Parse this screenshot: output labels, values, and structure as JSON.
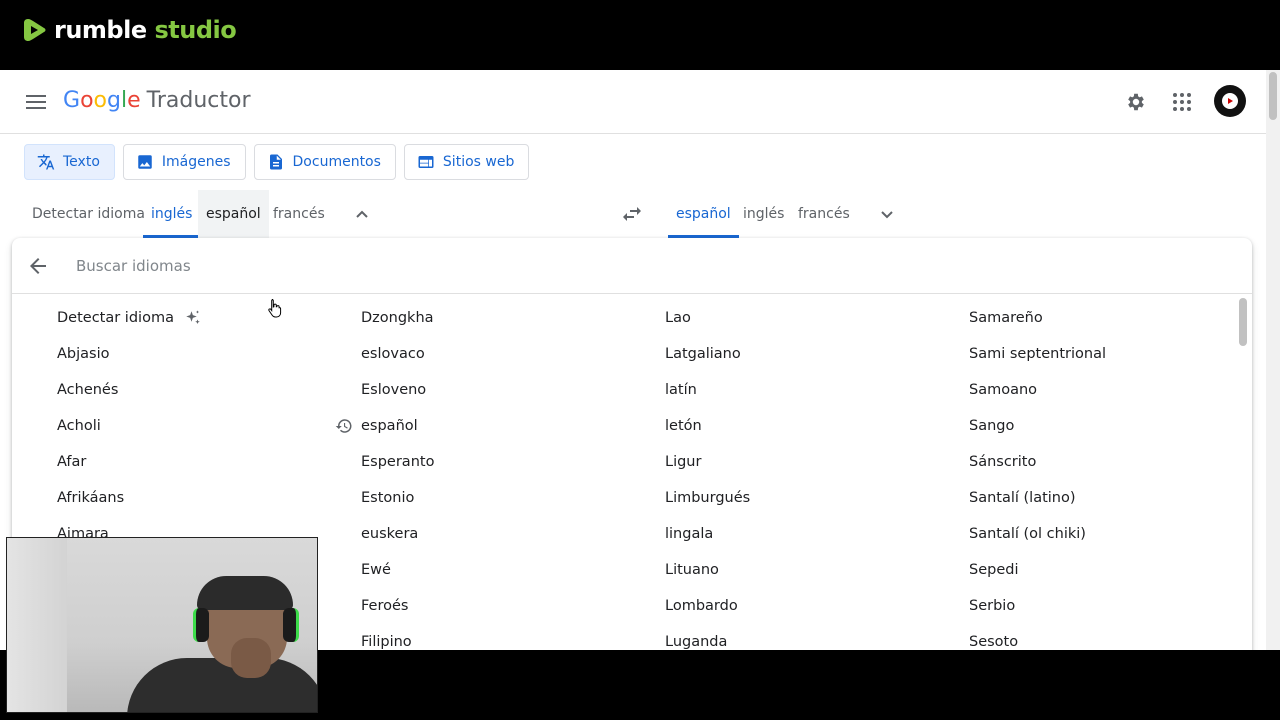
{
  "rumble": {
    "brand": "rumble",
    "studio": "studio"
  },
  "header": {
    "logo_letters": [
      "G",
      "o",
      "o",
      "g",
      "l",
      "e"
    ],
    "product": "Traductor"
  },
  "mode_tabs": [
    {
      "label": "Texto",
      "icon": "translate-icon",
      "active": true
    },
    {
      "label": "Imágenes",
      "icon": "image-icon",
      "active": false
    },
    {
      "label": "Documentos",
      "icon": "document-icon",
      "active": false
    },
    {
      "label": "Sitios web",
      "icon": "web-icon",
      "active": false
    }
  ],
  "source_langs": [
    "Detectar idioma",
    "inglés",
    "español",
    "francés"
  ],
  "target_langs": [
    "español",
    "inglés",
    "francés"
  ],
  "search": {
    "placeholder": "Buscar idiomas",
    "value": ""
  },
  "languages": {
    "col1": [
      "Detectar idioma",
      "Abjasio",
      "Achenés",
      "Acholi",
      "Afar",
      "Afrikáans",
      "Aimara",
      "",
      "",
      ""
    ],
    "col2": [
      "Dzongkha",
      "eslovaco",
      "Esloveno",
      "español",
      "Esperanto",
      "Estonio",
      "euskera",
      "Ewé",
      "Feroés",
      "Filipino"
    ],
    "col3": [
      "Lao",
      "Latgaliano",
      "latín",
      "letón",
      "Ligur",
      "Limburgués",
      "lingala",
      "Lituano",
      "Lombardo",
      "Luganda"
    ],
    "col4": [
      "Samareño",
      "Sami septentrional",
      "Samoano",
      "Sango",
      "Sánscrito",
      "Santalí (latino)",
      "Santalí (ol chiki)",
      "Sepedi",
      "Serbio",
      "Sesoto"
    ]
  },
  "colors": {
    "accent": "#1967d2",
    "rumble_green": "#85c742"
  }
}
